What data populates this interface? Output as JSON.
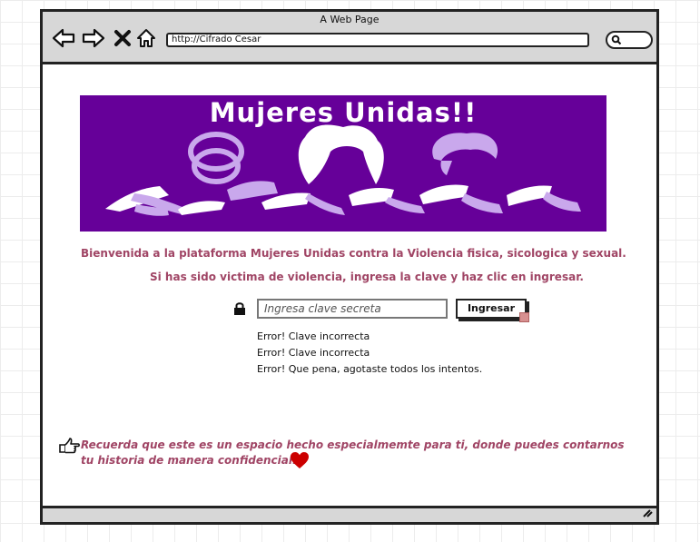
{
  "window": {
    "title": "A Web Page",
    "url": "http://Cifrado Cesar"
  },
  "banner": {
    "title": "Mujeres Unidas!!",
    "background_color": "#660099"
  },
  "content": {
    "welcome_text": "Bienvenida a la plataforma Mujeres Unidas contra la Violencia fisica, sicologica y sexual.",
    "instruction_text": "Si has sido victima de violencia, ingresa  la clave y haz clic en  ingresar."
  },
  "login": {
    "password_placeholder": "Ingresa clave secreta",
    "submit_label": "Ingresar"
  },
  "errors": [
    "Error! Clave incorrecta",
    "Error! Clave incorrecta",
    "Error! Que pena, agotaste todos los intentos."
  ],
  "footer": {
    "note": "Recuerda que este es un espacio hecho especialmemte para ti, donde  puedes contarnos tu historia de manera confidencial."
  },
  "icons": [
    "back-arrow-icon",
    "forward-arrow-icon",
    "close-icon",
    "home-icon",
    "search-icon",
    "lock-icon",
    "pointing-hand-icon",
    "heart-icon",
    "resize-grip-icon"
  ],
  "colors": {
    "accent_text": "#a04565",
    "banner_purple": "#660099",
    "heart": "#cc0000"
  }
}
